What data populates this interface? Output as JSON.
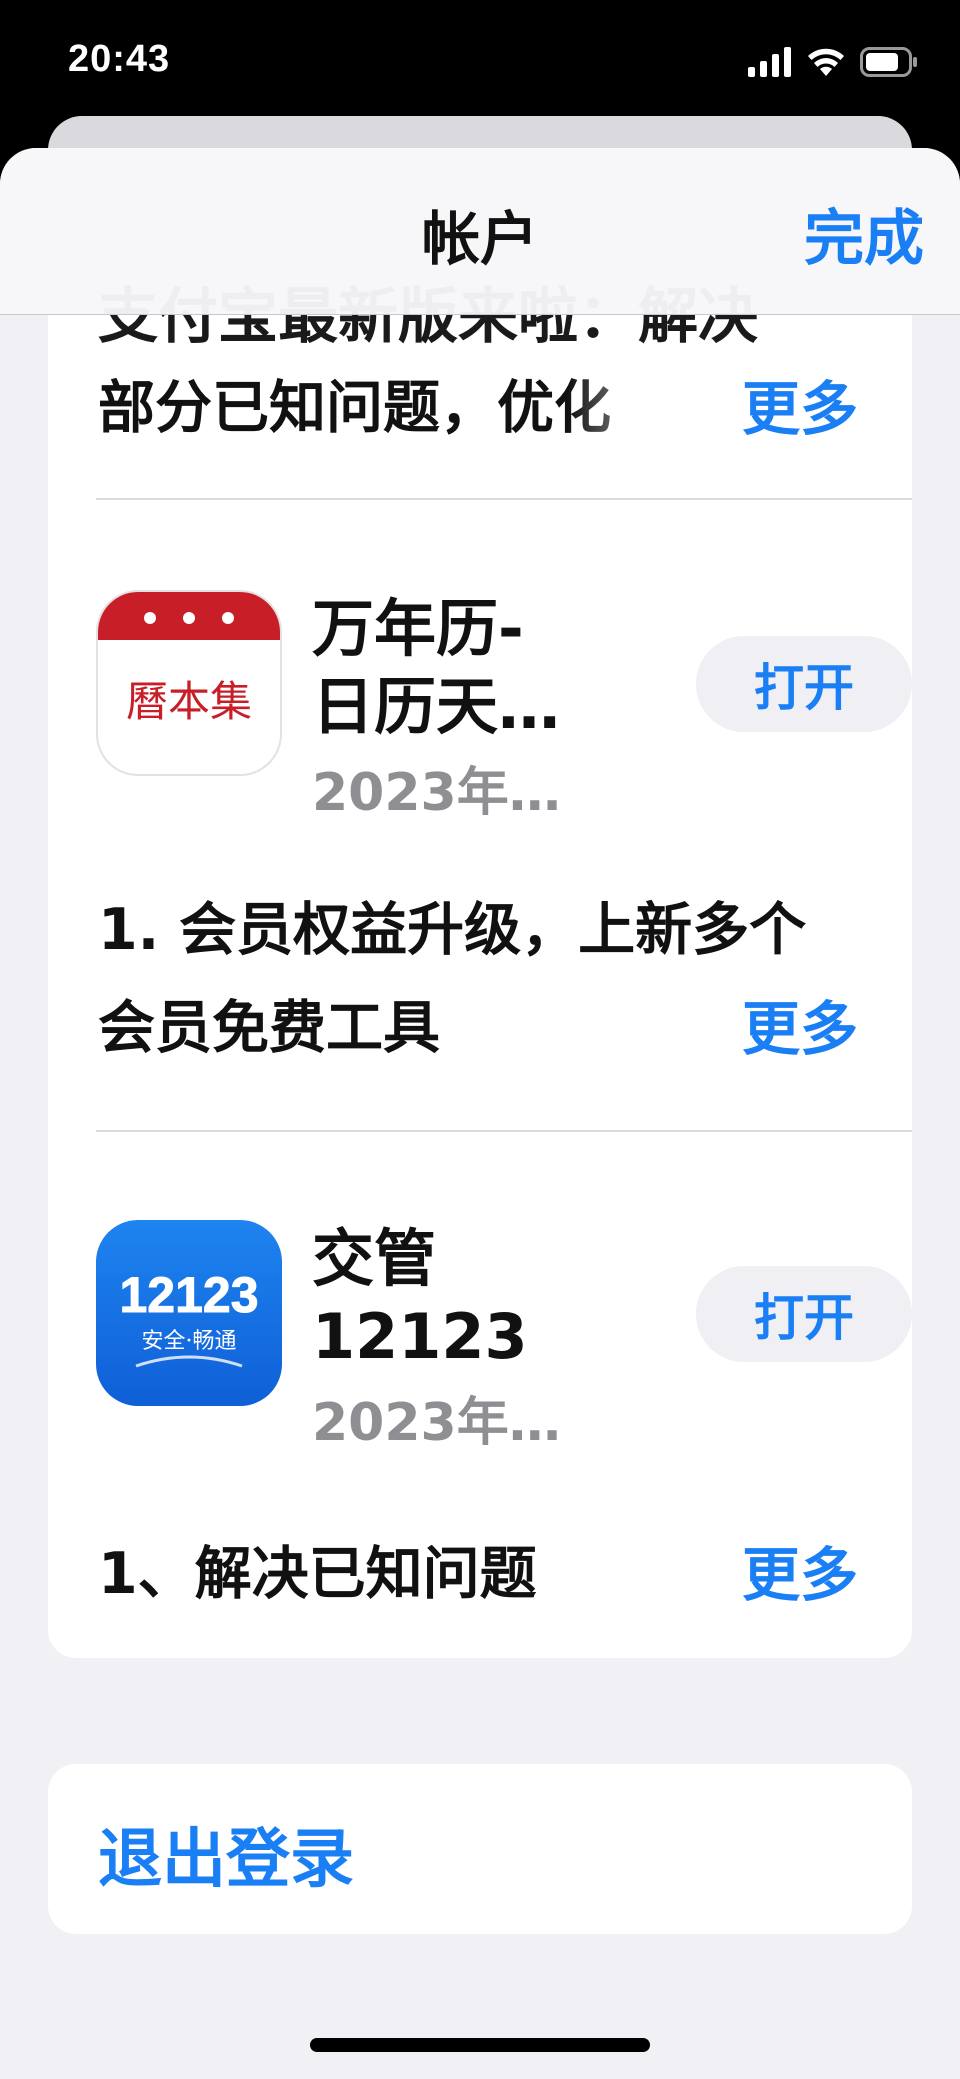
{
  "status_bar": {
    "time": "20:43"
  },
  "nav": {
    "title": "帐户",
    "done_label": "完成"
  },
  "updates": {
    "partial_top_line": "支付宝最新版来啦：解决",
    "prev_description": "部分已知问题，优化",
    "more_label": "更多",
    "apps": [
      {
        "name_line1": "万年历-",
        "name_line2": "日历天…",
        "date": "2023年…",
        "open_label": "打开",
        "icon": "calendar-icon",
        "icon_text": "曆本集",
        "description_line1": "1. 会员权益升级，上新多个",
        "description_line2": "会员免费工具"
      },
      {
        "name_line1": "交管",
        "name_line2": "12123",
        "date": "2023年…",
        "open_label": "打开",
        "icon": "traffic-police-icon",
        "icon_text": "12123",
        "icon_subtext": "安全·畅通",
        "description_line1": "1、解决已知问题"
      }
    ]
  },
  "logout_label": "退出登录",
  "colors": {
    "accent": "#1a7ff5",
    "secondary_text": "#8e8e93",
    "calendar_red": "#c81e28"
  }
}
